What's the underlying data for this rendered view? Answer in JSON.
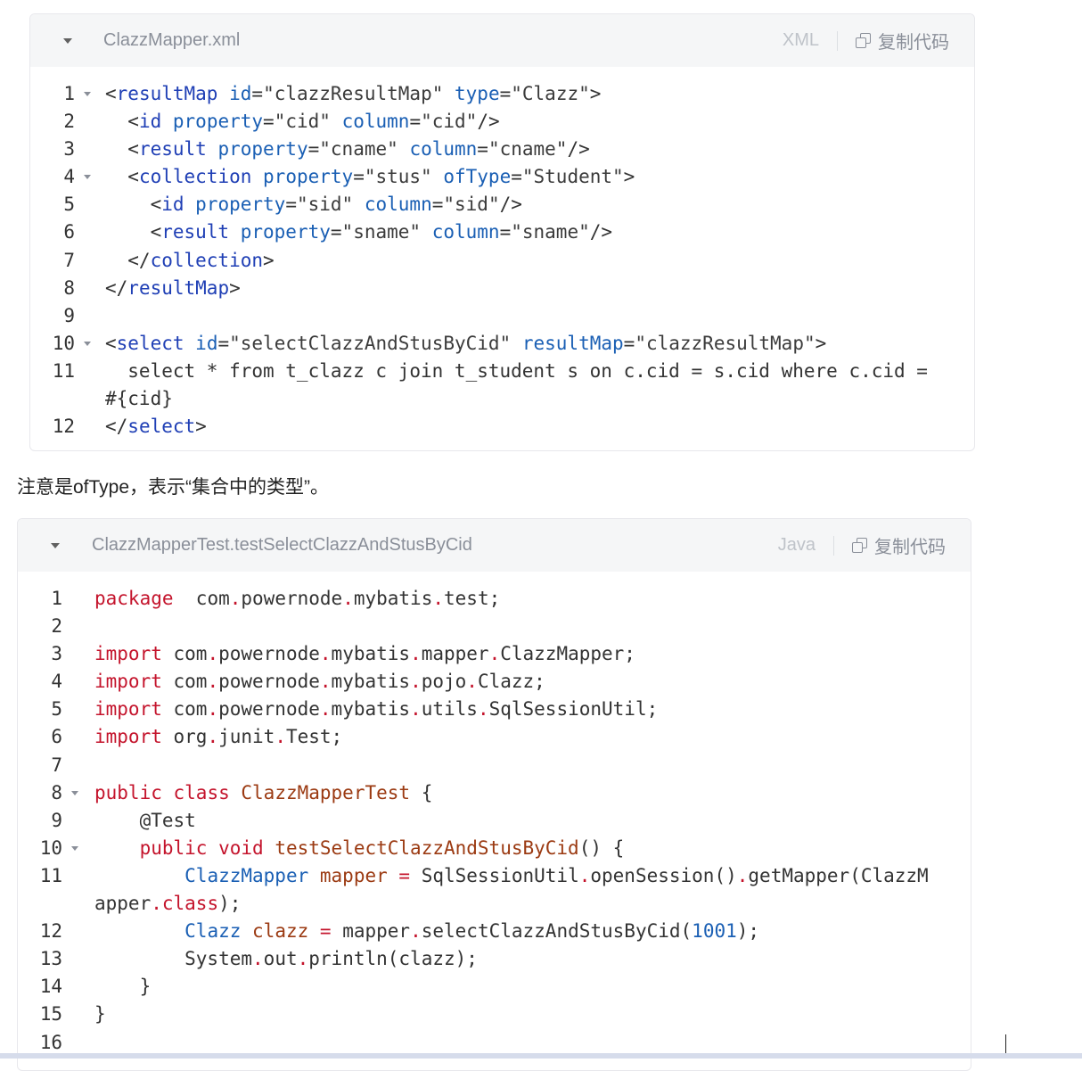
{
  "xml_block": {
    "filename": "ClazzMapper.xml",
    "language": "XML",
    "copy_label": "复制代码",
    "lines": [
      {
        "n": "1",
        "fold": true,
        "rows": [
          [
            [
              "x-br",
              "<"
            ],
            [
              "x-tag",
              "resultMap"
            ],
            [
              "x-br",
              " "
            ],
            [
              "x-attr",
              "id"
            ],
            [
              "x-br",
              "="
            ],
            [
              "x-str",
              "\"clazzResultMap\""
            ],
            [
              "x-br",
              " "
            ],
            [
              "x-attr",
              "type"
            ],
            [
              "x-br",
              "="
            ],
            [
              "x-str",
              "\"Clazz\""
            ],
            [
              "x-br",
              ">"
            ]
          ]
        ]
      },
      {
        "n": "2",
        "fold": false,
        "rows": [
          [
            [
              "x-br",
              "  <"
            ],
            [
              "x-tag",
              "id"
            ],
            [
              "x-br",
              " "
            ],
            [
              "x-attr",
              "property"
            ],
            [
              "x-br",
              "="
            ],
            [
              "x-str",
              "\"cid\""
            ],
            [
              "x-br",
              " "
            ],
            [
              "x-attr",
              "column"
            ],
            [
              "x-br",
              "="
            ],
            [
              "x-str",
              "\"cid\""
            ],
            [
              "x-br",
              "/>"
            ]
          ]
        ]
      },
      {
        "n": "3",
        "fold": false,
        "rows": [
          [
            [
              "x-br",
              "  <"
            ],
            [
              "x-tag",
              "result"
            ],
            [
              "x-br",
              " "
            ],
            [
              "x-attr",
              "property"
            ],
            [
              "x-br",
              "="
            ],
            [
              "x-str",
              "\"cname\""
            ],
            [
              "x-br",
              " "
            ],
            [
              "x-attr",
              "column"
            ],
            [
              "x-br",
              "="
            ],
            [
              "x-str",
              "\"cname\""
            ],
            [
              "x-br",
              "/>"
            ]
          ]
        ]
      },
      {
        "n": "4",
        "fold": true,
        "rows": [
          [
            [
              "x-br",
              "  <"
            ],
            [
              "x-tag",
              "collection"
            ],
            [
              "x-br",
              " "
            ],
            [
              "x-attr",
              "property"
            ],
            [
              "x-br",
              "="
            ],
            [
              "x-str",
              "\"stus\""
            ],
            [
              "x-br",
              " "
            ],
            [
              "x-attr",
              "ofType"
            ],
            [
              "x-br",
              "="
            ],
            [
              "x-str",
              "\"Student\""
            ],
            [
              "x-br",
              ">"
            ]
          ]
        ]
      },
      {
        "n": "5",
        "fold": false,
        "rows": [
          [
            [
              "x-br",
              "    <"
            ],
            [
              "x-tag",
              "id"
            ],
            [
              "x-br",
              " "
            ],
            [
              "x-attr",
              "property"
            ],
            [
              "x-br",
              "="
            ],
            [
              "x-str",
              "\"sid\""
            ],
            [
              "x-br",
              " "
            ],
            [
              "x-attr",
              "column"
            ],
            [
              "x-br",
              "="
            ],
            [
              "x-str",
              "\"sid\""
            ],
            [
              "x-br",
              "/>"
            ]
          ]
        ]
      },
      {
        "n": "6",
        "fold": false,
        "rows": [
          [
            [
              "x-br",
              "    <"
            ],
            [
              "x-tag",
              "result"
            ],
            [
              "x-br",
              " "
            ],
            [
              "x-attr",
              "property"
            ],
            [
              "x-br",
              "="
            ],
            [
              "x-str",
              "\"sname\""
            ],
            [
              "x-br",
              " "
            ],
            [
              "x-attr",
              "column"
            ],
            [
              "x-br",
              "="
            ],
            [
              "x-str",
              "\"sname\""
            ],
            [
              "x-br",
              "/>"
            ]
          ]
        ]
      },
      {
        "n": "7",
        "fold": false,
        "rows": [
          [
            [
              "x-br",
              "  </"
            ],
            [
              "x-tag",
              "collection"
            ],
            [
              "x-br",
              ">"
            ]
          ]
        ]
      },
      {
        "n": "8",
        "fold": false,
        "rows": [
          [
            [
              "x-br",
              "</"
            ],
            [
              "x-tag",
              "resultMap"
            ],
            [
              "x-br",
              ">"
            ]
          ]
        ]
      },
      {
        "n": "9",
        "fold": false,
        "rows": [
          [
            [
              "x-br",
              ""
            ]
          ]
        ]
      },
      {
        "n": "10",
        "fold": true,
        "rows": [
          [
            [
              "x-br",
              "<"
            ],
            [
              "x-tag",
              "select"
            ],
            [
              "x-br",
              " "
            ],
            [
              "x-attr",
              "id"
            ],
            [
              "x-br",
              "="
            ],
            [
              "x-str",
              "\"selectClazzAndStusByCid\""
            ],
            [
              "x-br",
              " "
            ],
            [
              "x-attr",
              "resultMap"
            ],
            [
              "x-br",
              "="
            ],
            [
              "x-str",
              "\"clazzResultMap\""
            ],
            [
              "x-br",
              ">"
            ]
          ]
        ]
      },
      {
        "n": "11",
        "fold": false,
        "rows": [
          [
            [
              "x-br",
              "  select * from t_clazz c join t_student s on c.cid = s.cid where c.cid ="
            ]
          ],
          [
            [
              "x-br",
              "#{cid}"
            ]
          ]
        ]
      },
      {
        "n": "12",
        "fold": false,
        "rows": [
          [
            [
              "x-br",
              "</"
            ],
            [
              "x-tag",
              "select"
            ],
            [
              "x-br",
              ">"
            ]
          ]
        ]
      }
    ]
  },
  "note_text": "注意是ofType，表示“集合中的类型”。",
  "java_block": {
    "filename": "ClazzMapperTest.testSelectClazzAndStusByCid",
    "language": "Java",
    "copy_label": "复制代码",
    "lines": [
      {
        "n": "1",
        "fold": false,
        "rows": [
          [
            [
              "j-kw",
              "package"
            ],
            [
              "",
              "  com"
            ],
            [
              "j-dot",
              "."
            ],
            [
              "",
              "powernode"
            ],
            [
              "j-dot",
              "."
            ],
            [
              "",
              "mybatis"
            ],
            [
              "j-dot",
              "."
            ],
            [
              "",
              "test;"
            ]
          ]
        ]
      },
      {
        "n": "2",
        "fold": false,
        "rows": [
          [
            [
              "",
              ""
            ]
          ]
        ]
      },
      {
        "n": "3",
        "fold": false,
        "rows": [
          [
            [
              "j-kw",
              "import"
            ],
            [
              "",
              " com"
            ],
            [
              "j-dot",
              "."
            ],
            [
              "",
              "powernode"
            ],
            [
              "j-dot",
              "."
            ],
            [
              "",
              "mybatis"
            ],
            [
              "j-dot",
              "."
            ],
            [
              "",
              "mapper"
            ],
            [
              "j-dot",
              "."
            ],
            [
              "",
              "ClazzMapper;"
            ]
          ]
        ]
      },
      {
        "n": "4",
        "fold": false,
        "rows": [
          [
            [
              "j-kw",
              "import"
            ],
            [
              "",
              " com"
            ],
            [
              "j-dot",
              "."
            ],
            [
              "",
              "powernode"
            ],
            [
              "j-dot",
              "."
            ],
            [
              "",
              "mybatis"
            ],
            [
              "j-dot",
              "."
            ],
            [
              "",
              "pojo"
            ],
            [
              "j-dot",
              "."
            ],
            [
              "",
              "Clazz;"
            ]
          ]
        ]
      },
      {
        "n": "5",
        "fold": false,
        "rows": [
          [
            [
              "j-kw",
              "import"
            ],
            [
              "",
              " com"
            ],
            [
              "j-dot",
              "."
            ],
            [
              "",
              "powernode"
            ],
            [
              "j-dot",
              "."
            ],
            [
              "",
              "mybatis"
            ],
            [
              "j-dot",
              "."
            ],
            [
              "",
              "utils"
            ],
            [
              "j-dot",
              "."
            ],
            [
              "",
              "SqlSessionUtil;"
            ]
          ]
        ]
      },
      {
        "n": "6",
        "fold": false,
        "rows": [
          [
            [
              "j-kw",
              "import"
            ],
            [
              "",
              " org"
            ],
            [
              "j-dot",
              "."
            ],
            [
              "",
              "junit"
            ],
            [
              "j-dot",
              "."
            ],
            [
              "",
              "Test;"
            ]
          ]
        ]
      },
      {
        "n": "7",
        "fold": false,
        "rows": [
          [
            [
              "",
              ""
            ]
          ]
        ]
      },
      {
        "n": "8",
        "fold": true,
        "rows": [
          [
            [
              "j-kw",
              "public"
            ],
            [
              "",
              " "
            ],
            [
              "j-kw",
              "class"
            ],
            [
              "",
              " "
            ],
            [
              "j-cls",
              "ClazzMapperTest"
            ],
            [
              "",
              " {"
            ]
          ]
        ]
      },
      {
        "n": "9",
        "fold": false,
        "rows": [
          [
            [
              "",
              "    @Test"
            ]
          ]
        ]
      },
      {
        "n": "10",
        "fold": true,
        "rows": [
          [
            [
              "",
              "    "
            ],
            [
              "j-kw",
              "public"
            ],
            [
              "",
              " "
            ],
            [
              "j-kw",
              "void"
            ],
            [
              "",
              " "
            ],
            [
              "j-cls",
              "testSelectClazzAndStusByCid"
            ],
            [
              "",
              "() {"
            ]
          ]
        ]
      },
      {
        "n": "11",
        "fold": false,
        "rows": [
          [
            [
              "",
              "        "
            ],
            [
              "j-type",
              "ClazzMapper"
            ],
            [
              "",
              " "
            ],
            [
              "j-var",
              "mapper"
            ],
            [
              "",
              " "
            ],
            [
              "j-dot",
              "="
            ],
            [
              "",
              " SqlSessionUtil"
            ],
            [
              "j-dot",
              "."
            ],
            [
              "",
              "openSession()"
            ],
            [
              "j-dot",
              "."
            ],
            [
              "",
              "getMapper(ClazzM"
            ]
          ],
          [
            [
              "",
              "apper"
            ],
            [
              "j-dot",
              "."
            ],
            [
              "j-kw",
              "class"
            ],
            [
              "",
              ");"
            ]
          ]
        ]
      },
      {
        "n": "12",
        "fold": false,
        "rows": [
          [
            [
              "",
              "        "
            ],
            [
              "j-type",
              "Clazz"
            ],
            [
              "",
              " "
            ],
            [
              "j-var",
              "clazz"
            ],
            [
              "",
              " "
            ],
            [
              "j-dot",
              "="
            ],
            [
              "",
              " mapper"
            ],
            [
              "j-dot",
              "."
            ],
            [
              "",
              "selectClazzAndStusByCid("
            ],
            [
              "j-num",
              "1001"
            ],
            [
              "",
              ");"
            ]
          ]
        ]
      },
      {
        "n": "13",
        "fold": false,
        "rows": [
          [
            [
              "",
              "        System"
            ],
            [
              "j-dot",
              "."
            ],
            [
              "",
              "out"
            ],
            [
              "j-dot",
              "."
            ],
            [
              "",
              "println(clazz);"
            ]
          ]
        ]
      },
      {
        "n": "14",
        "fold": false,
        "rows": [
          [
            [
              "",
              "    }"
            ]
          ]
        ]
      },
      {
        "n": "15",
        "fold": false,
        "rows": [
          [
            [
              "",
              "}"
            ]
          ]
        ]
      },
      {
        "n": "16",
        "fold": false,
        "rows": [
          [
            [
              "",
              ""
            ]
          ]
        ]
      }
    ]
  }
}
